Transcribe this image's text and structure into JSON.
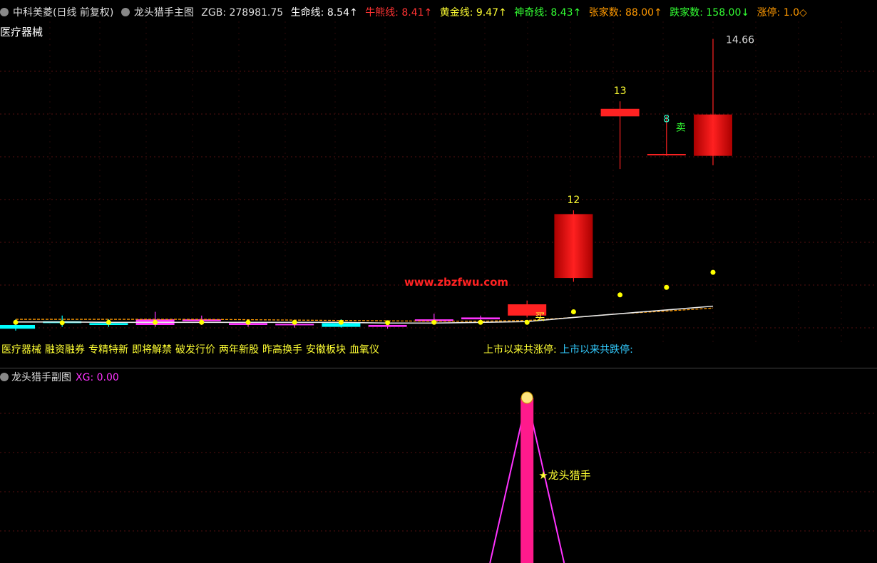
{
  "header": {
    "stock": "中科美菱(日线 前复权)",
    "indicator": "龙头猎手主图",
    "zgb": "ZGB: 278981.75",
    "life_line": "生命线: 8.54↑",
    "bull_line": "牛熊线: 8.41↑",
    "gold_line": "黄金线: 9.47↑",
    "magic_line": "神奇线: 8.43↑",
    "up_count": "张家数: 88.00↑",
    "down_count": "跌家数: 158.00↓",
    "limit_up": "涨停: 1.0◇"
  },
  "sector": "医疗器械",
  "watermark": "www.zbzfwu.com",
  "concept_tags": [
    "医疗器械",
    "融资融券",
    "专精特新",
    "即将解禁",
    "破发行价",
    "两年新股",
    "昨高换手",
    "安徽板块",
    "血氧仪"
  ],
  "ipo_stats": {
    "up": "上市以来共涨停:",
    "down": "上市以来共跌停:"
  },
  "sub_header": {
    "title": "龙头猎手副图",
    "xg": "XG: 0.00"
  },
  "signal_label": "★龙头猎手",
  "colors": {
    "up": "#ff2222",
    "down": "#00ffff",
    "magenta": "#ff33ff",
    "dot": "#ffff00",
    "line": "#e8e8e8",
    "orange": "#ff9900",
    "signal": "#ff1a8c"
  },
  "chart_data": {
    "type": "candlestick",
    "price_range": [
      6.5,
      14.9
    ],
    "candles": [
      {
        "o": 7.05,
        "h": 7.2,
        "l": 6.9,
        "c": 6.95,
        "color": "cyan"
      },
      {
        "o": 7.15,
        "h": 7.3,
        "l": 7.0,
        "c": 7.1,
        "color": "cyan"
      },
      {
        "o": 7.1,
        "h": 7.2,
        "l": 7.0,
        "c": 7.05,
        "color": "cyan"
      },
      {
        "o": 7.05,
        "h": 7.4,
        "l": 7.0,
        "c": 7.2,
        "color": "magenta"
      },
      {
        "o": 7.15,
        "h": 7.3,
        "l": 7.05,
        "c": 7.2,
        "color": "magenta"
      },
      {
        "o": 7.1,
        "h": 7.15,
        "l": 7.0,
        "c": 7.05,
        "color": "magenta"
      },
      {
        "o": 7.05,
        "h": 7.15,
        "l": 6.98,
        "c": 7.08,
        "color": "magenta"
      },
      {
        "o": 7.1,
        "h": 7.2,
        "l": 6.98,
        "c": 7.0,
        "color": "cyan"
      },
      {
        "o": 7.05,
        "h": 7.15,
        "l": 6.95,
        "c": 7.0,
        "color": "magenta"
      },
      {
        "o": 7.15,
        "h": 7.35,
        "l": 7.1,
        "c": 7.2,
        "color": "magenta"
      },
      {
        "o": 7.2,
        "h": 7.3,
        "l": 7.15,
        "c": 7.25,
        "color": "magenta"
      },
      {
        "o": 7.3,
        "h": 7.7,
        "l": 7.25,
        "c": 7.6,
        "color": "red",
        "label": "买"
      },
      {
        "o": 8.3,
        "h": 10.1,
        "l": 8.2,
        "c": 10.0,
        "color": "red",
        "label": "12"
      },
      {
        "o": 12.8,
        "h": 13.0,
        "l": 11.2,
        "c": 12.6,
        "color": "red",
        "label": "13"
      },
      {
        "o": 11.6,
        "h": 12.6,
        "l": 11.55,
        "c": 11.6,
        "color": "red",
        "label": "8",
        "tag": "卖"
      },
      {
        "o": 11.55,
        "h": 14.66,
        "l": 11.3,
        "c": 12.65,
        "color": "red",
        "label": "14.66"
      }
    ],
    "dots": [
      7.12,
      7.11,
      7.12,
      7.12,
      7.12,
      7.12,
      7.12,
      7.12,
      7.11,
      7.12,
      7.12,
      7.12,
      7.4,
      7.85,
      8.05,
      8.45
    ],
    "lines": {
      "white": [
        7.13,
        7.13,
        7.12,
        7.12,
        7.12,
        7.12,
        7.12,
        7.12,
        7.1,
        7.1,
        7.12,
        7.14,
        7.25,
        7.35,
        7.45,
        7.55
      ],
      "orange": [
        7.2,
        7.2,
        7.2,
        7.2,
        7.2,
        7.19,
        7.18,
        7.17,
        7.16,
        7.15,
        7.15,
        7.17,
        7.25,
        7.35,
        7.42,
        7.5
      ]
    },
    "signal_index": 11
  }
}
